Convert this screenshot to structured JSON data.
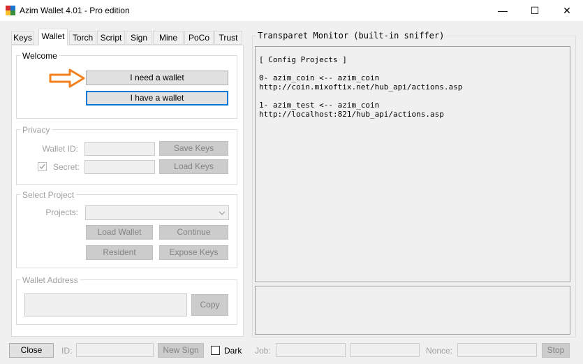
{
  "window": {
    "title": "Azim Wallet 4.01 - Pro edition",
    "minimize_glyph": "—",
    "maximize_glyph": "☐",
    "close_glyph": "✕"
  },
  "tabs": [
    {
      "label": "Keys",
      "active": false
    },
    {
      "label": "Wallet",
      "active": true
    },
    {
      "label": "Torch",
      "active": false
    },
    {
      "label": "Script",
      "active": false
    },
    {
      "label": "Sign",
      "active": false
    },
    {
      "label": "Mine",
      "active": false
    },
    {
      "label": "PoCo",
      "active": false
    },
    {
      "label": "Trust",
      "active": false
    }
  ],
  "welcome": {
    "title": "Welcome",
    "need_wallet": "I need a wallet",
    "have_wallet": "I have a wallet"
  },
  "privacy": {
    "title": "Privacy",
    "wallet_id_label": "Wallet ID:",
    "wallet_id_value": "",
    "secret_label": "Secret:",
    "secret_value": "",
    "save_keys": "Save Keys",
    "load_keys": "Load Keys",
    "secret_checked": true
  },
  "select_project": {
    "title": "Select Project",
    "projects_label": "Projects:",
    "projects_value": "",
    "load_wallet": "Load Wallet",
    "continue": "Continue",
    "resident": "Resident",
    "expose_keys": "Expose Keys"
  },
  "wallet_address": {
    "title": "Wallet Address",
    "value": "",
    "copy": "Copy"
  },
  "monitor": {
    "title": "Transparet Monitor (built-in sniffer)",
    "log": "[ Config Projects ]\n\n0- azim_coin <-- azim_coin\nhttp://coin.mixoftix.net/hub_api/actions.asp\n\n1- azim_test <-- azim_coin\nhttp://localhost:821/hub_api/actions.asp"
  },
  "bottom": {
    "close": "Close",
    "id_label": "ID:",
    "id_value": "",
    "new_sign": "New Sign",
    "dark_label": "Dark",
    "job_label": "Job:",
    "job_value": "",
    "job_value2": "",
    "nonce_label": "Nonce:",
    "nonce_value": "",
    "stop": "Stop"
  },
  "colors": {
    "accent": "#0078d7",
    "arrow": "#f58220"
  }
}
